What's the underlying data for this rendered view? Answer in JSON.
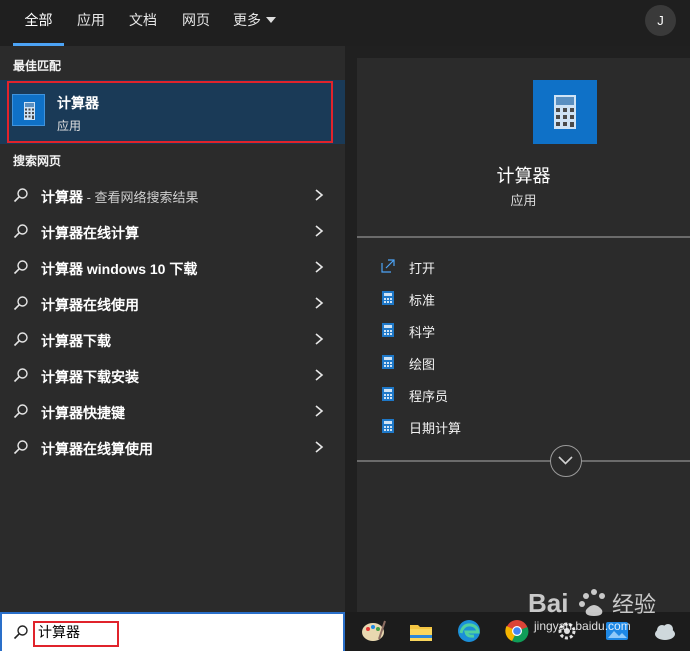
{
  "tabs": [
    {
      "label": "全部"
    },
    {
      "label": "应用"
    },
    {
      "label": "文档"
    },
    {
      "label": "网页"
    },
    {
      "label": "更多"
    }
  ],
  "user": {
    "initial": "J"
  },
  "best_match": {
    "section_title": "最佳匹配",
    "name": "计算器",
    "type": "应用"
  },
  "web": {
    "section_title": "搜索网页",
    "results": [
      {
        "label": "计算器",
        "suffix": " - 查看网络搜索结果"
      },
      {
        "label": "计算器在线计算",
        "suffix": ""
      },
      {
        "label": "计算器 windows 10 下载",
        "suffix": ""
      },
      {
        "label": "计算器在线使用",
        "suffix": ""
      },
      {
        "label": "计算器下载",
        "suffix": ""
      },
      {
        "label": "计算器下载安装",
        "suffix": ""
      },
      {
        "label": "计算器快捷键",
        "suffix": ""
      },
      {
        "label": "计算器在线算使用",
        "suffix": ""
      }
    ]
  },
  "preview": {
    "name": "计算器",
    "type": "应用",
    "actions": [
      {
        "label": "打开",
        "icon": "open-icon"
      },
      {
        "label": "标准",
        "icon": "calculator-icon"
      },
      {
        "label": "科学",
        "icon": "calculator-icon"
      },
      {
        "label": "绘图",
        "icon": "calculator-icon"
      },
      {
        "label": "程序员",
        "icon": "calculator-icon"
      },
      {
        "label": "日期计算",
        "icon": "calculator-icon"
      }
    ]
  },
  "search": {
    "value": "计算器"
  },
  "watermark": {
    "brand": "Bai 经验",
    "url": "jingyan.baidu.com"
  },
  "colors": {
    "accent": "#4ca3f5",
    "highlight": "#e0232b",
    "app_blue": "#0f71c7",
    "selected_bg": "#1a3a57"
  }
}
